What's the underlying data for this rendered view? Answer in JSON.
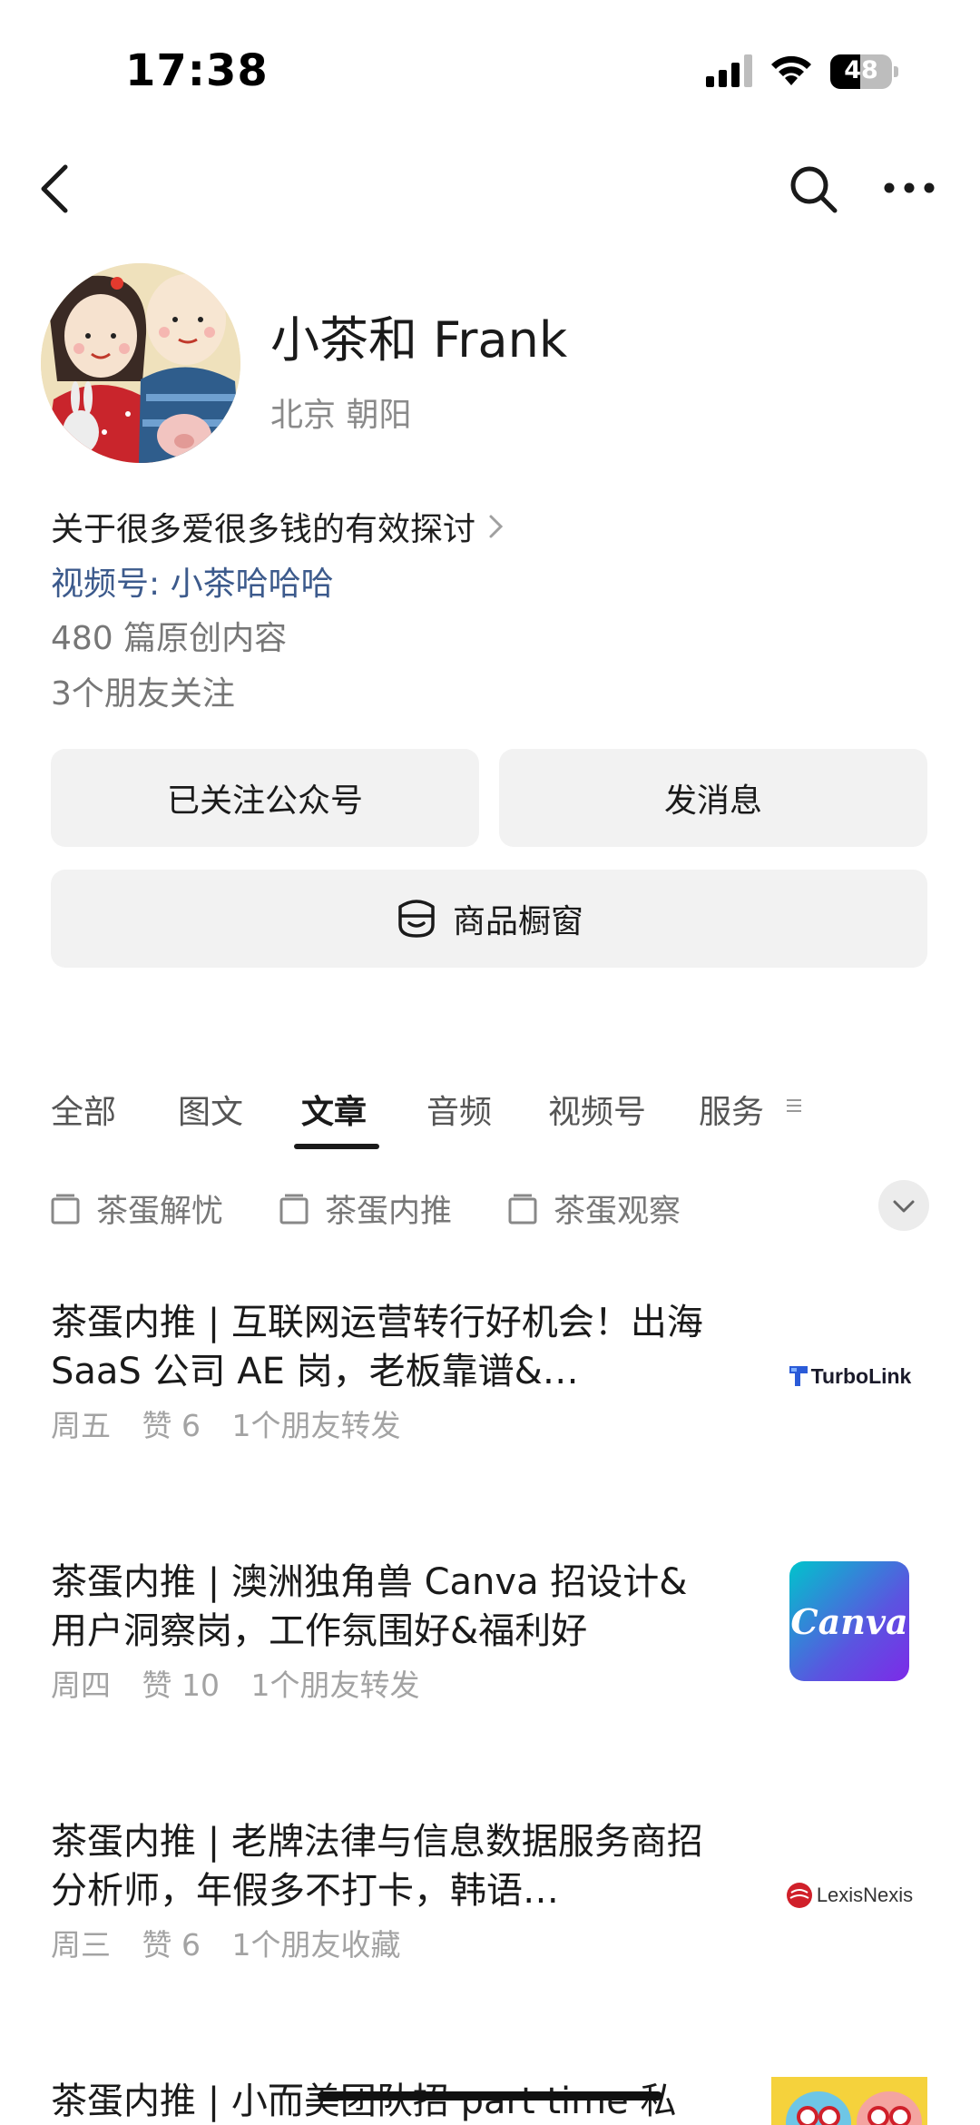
{
  "status_bar": {
    "time": "17:38",
    "battery": "48",
    "battery_level": 0.48
  },
  "nav": {
    "back_icon": "chevron-left-icon",
    "search_icon": "search-icon",
    "more_icon": "more-icon"
  },
  "profile": {
    "name": "小茶和 Frank",
    "location": "北京 朝阳",
    "description": "关于很多爱很多钱的有效探讨",
    "video_channel": "视频号: 小茶哈哈哈",
    "original_count": "480 篇原创内容",
    "friends_following": "3个朋友关注"
  },
  "buttons": {
    "follow": "已关注公众号",
    "message": "发消息",
    "shop": "商品橱窗"
  },
  "tabs": [
    {
      "label": "全部"
    },
    {
      "label": "图文"
    },
    {
      "label": "文章"
    },
    {
      "label": "音频"
    },
    {
      "label": "视频号"
    },
    {
      "label": "服务"
    }
  ],
  "active_tab": "文章",
  "albums": [
    {
      "label": "茶蛋解忧"
    },
    {
      "label": "茶蛋内推"
    },
    {
      "label": "茶蛋观察"
    }
  ],
  "articles": [
    {
      "title": "茶蛋内推 | 互联网运营转行好机会！出海 SaaS 公司 AE 岗，老板靠谱&…",
      "day": "周五",
      "likes": "赞 6",
      "social": "1个朋友转发",
      "thumb_text": "TurboLink"
    },
    {
      "title": "茶蛋内推 | 澳洲独角兽 Canva 招设计&用户洞察岗，工作氛围好&福利好",
      "day": "周四",
      "likes": "赞 10",
      "social": "1个朋友转发",
      "thumb_text": "Canva"
    },
    {
      "title": "茶蛋内推 | 老牌法律与信息数据服务商招分析师，年假多不打卡，韩语…",
      "day": "周三",
      "likes": "赞 6",
      "social": "1个朋友收藏",
      "thumb_text": "LexisNexis"
    },
    {
      "title": "茶蛋内推 | 小而美团队招 part time 私",
      "day": "",
      "likes": "",
      "social": "",
      "thumb_text": ""
    }
  ],
  "colors": {
    "link": "#3c5a8c",
    "button_bg": "#f2f2f2",
    "muted": "#a3a3a3",
    "canva_start": "#00c4cc",
    "canva_end": "#7d2ae8",
    "lexis_red": "#d0202a"
  }
}
